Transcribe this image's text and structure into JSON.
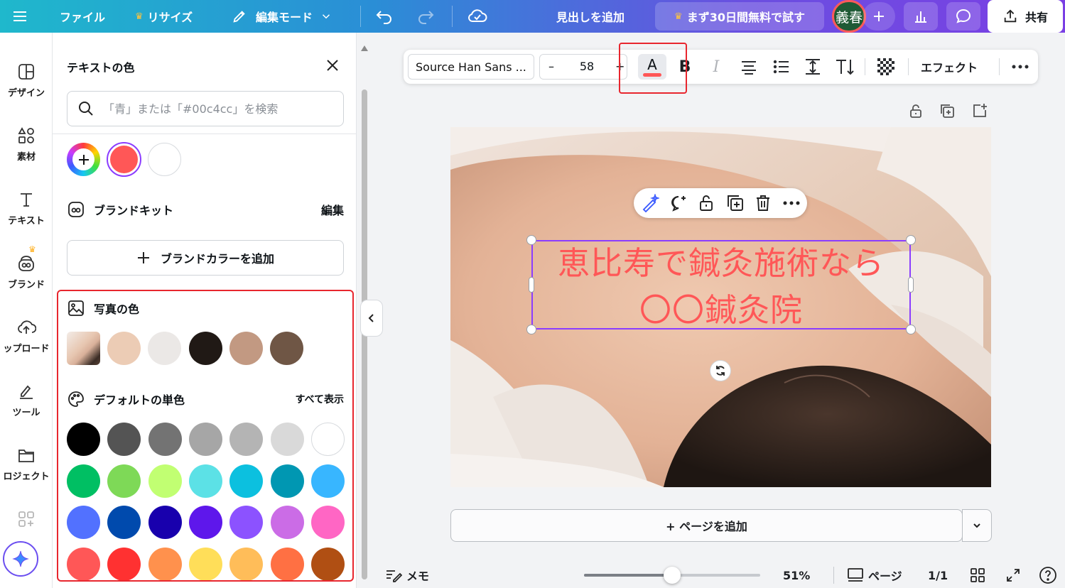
{
  "topbar": {
    "file": "ファイル",
    "resize": "リサイズ",
    "edit_mode": "編集モード",
    "add_heading": "見出しを追加",
    "trial": "まず30日間無料で試す",
    "avatar": "義春",
    "share": "共有"
  },
  "rail": {
    "design": "デザイン",
    "elements": "素材",
    "text": "テキスト",
    "brand": "ブランド",
    "uploads": "ップロード",
    "tools": "ツール",
    "projects": "ロジェクト"
  },
  "panel": {
    "title": "テキストの色",
    "search_placeholder": "「青」または「#00c4cc」を検索",
    "document_colors": [
      "#ff5757",
      "#ffffff"
    ],
    "brand_kit": "ブランドキット",
    "brand_edit": "編集",
    "add_brand_color": "ブランドカラーを追加",
    "photo_colors_title": "写真の色",
    "photo_colors": [
      "#ecccb5",
      "#ebe8e6",
      "#201915",
      "#c29982",
      "#6f5645"
    ],
    "default_title": "デフォルトの単色",
    "show_all": "すべて表示",
    "default_colors": [
      [
        "#000000",
        "#545454",
        "#737373",
        "#a6a6a6",
        "#b4b4b4",
        "#d9d9d9",
        "#ffffff"
      ],
      [
        "#00bf63",
        "#7ed957",
        "#c1ff72",
        "#5ce1e6",
        "#0cc0df",
        "#0097b2",
        "#38b6ff"
      ],
      [
        "#5271ff",
        "#004aad",
        "#1800ad",
        "#5e17eb",
        "#8c52ff",
        "#cb6ce6",
        "#ff66c4"
      ],
      [
        "#ff5757",
        "#ff3131",
        "#ff914d",
        "#ffde59",
        "#ffbd59",
        "#ff7043",
        "#b04f13"
      ]
    ]
  },
  "format_toolbar": {
    "font": "Source Han Sans ...",
    "minus": "–",
    "size": "58",
    "plus": "+",
    "color_letter": "A",
    "bold": "B",
    "italic": "I",
    "effects": "エフェクト",
    "text_color": "#ff5757"
  },
  "canvas": {
    "headline_line1": "恵比寿で鍼灸施術なら",
    "headline_line2": "〇〇鍼灸院"
  },
  "add_page": "+ ページを追加",
  "bottombar": {
    "notes": "メモ",
    "zoom": "51%",
    "zoom_fraction": 0.5,
    "pages": "ページ",
    "page_count": "1/1"
  },
  "colors": {
    "accent": "#8b3dff",
    "highlight": "#e8262e"
  }
}
